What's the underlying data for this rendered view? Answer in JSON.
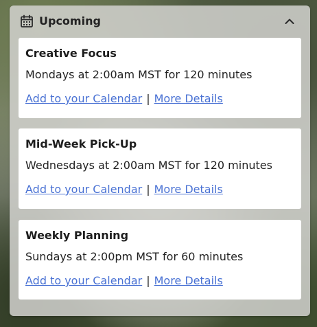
{
  "widget": {
    "title": "Upcoming",
    "icons": {
      "header": "calendar-icon",
      "toggle": "chevron-up-icon"
    }
  },
  "events": [
    {
      "title": "Creative Focus",
      "schedule": "Mondays at 2:00am MST for 120 minutes",
      "calendar_link": "Add to your Calendar",
      "separator": "|",
      "details_link": "More Details"
    },
    {
      "title": "Mid-Week Pick-Up",
      "schedule": "Wednesdays at 2:00am MST for 120 minutes",
      "calendar_link": "Add to your Calendar",
      "separator": "|",
      "details_link": "More Details"
    },
    {
      "title": "Weekly Planning",
      "schedule": "Sundays at 2:00pm MST for 60 minutes",
      "calendar_link": "Add to your Calendar",
      "separator": "|",
      "details_link": "More Details"
    }
  ],
  "colors": {
    "link": "#4a72d4",
    "panel": "#d2d2ce",
    "card": "#ffffff",
    "text": "#222222"
  }
}
